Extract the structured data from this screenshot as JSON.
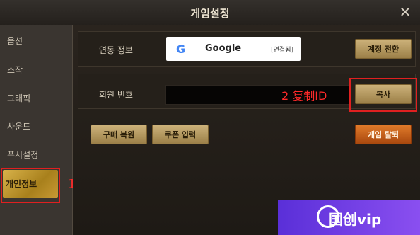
{
  "window": {
    "title": "게임설정"
  },
  "sidebar": {
    "items": [
      {
        "label": "옵션"
      },
      {
        "label": "조작"
      },
      {
        "label": "그래픽"
      },
      {
        "label": "사운드"
      },
      {
        "label": "푸시설정"
      },
      {
        "label": "개인정보"
      }
    ],
    "active_index": 5
  },
  "account": {
    "link_label": "연동 정보",
    "provider_name": "Google",
    "linked_badge": "[연결됨]",
    "switch_button": "계정 전환"
  },
  "member": {
    "label": "회원 번호",
    "copy_button": "복사"
  },
  "actions": {
    "restore_purchase": "구매 복원",
    "coupon_input": "쿠폰 입력",
    "withdraw": "게임 탈퇴"
  },
  "annotations": {
    "step1": "1",
    "step2": "2 复制ID"
  },
  "watermark": {
    "text": "国创vip"
  },
  "colors": {
    "accent_gold": "#d8b24a",
    "annotation_red": "#ff2a2a",
    "withdraw_orange": "#e07a2a"
  }
}
